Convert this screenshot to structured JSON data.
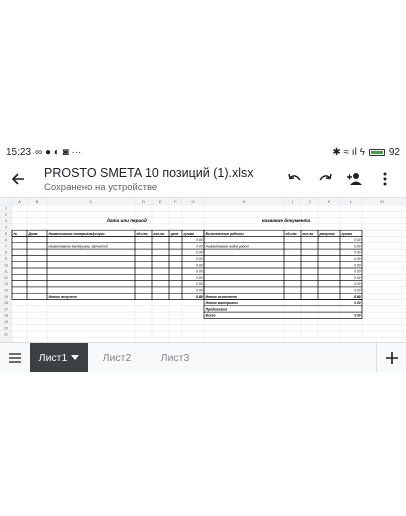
{
  "status": {
    "time": "15:23",
    "notif": "∞ ● ◐ ◙ ···",
    "sys": "✱ ≈ ıl ϟ",
    "battery": "92"
  },
  "header": {
    "title": "PROSTO SMETA 10 позиций (1).xlsx",
    "subtitle": "Сохранено на устройстве"
  },
  "icons": {
    "back": "arrow-left-icon",
    "undo": "undo-icon",
    "redo": "redo-icon",
    "share": "add-person-icon",
    "more": "more-vert-icon",
    "menu": "menu-icon",
    "add": "plus-icon"
  },
  "sheet": {
    "columns": [
      "A",
      "B",
      "C",
      "D",
      "E",
      "F",
      "G",
      "H",
      "I",
      "J",
      "K",
      "L",
      "M"
    ],
    "rows": [
      "1",
      "2",
      "3",
      "4",
      "5",
      "6",
      "7",
      "8",
      "9",
      "10",
      "11",
      "12",
      "13",
      "14",
      "15",
      "16",
      "17",
      "18",
      "19",
      "20",
      "21"
    ],
    "title_left": "дата или период",
    "title_right": "название документа",
    "headers": [
      "№",
      "Дата",
      "Наименование материала/услуги",
      "ед.изм.",
      "кол-во",
      "цена",
      "сумма",
      "Выполненные работы",
      "ед.изм.",
      "кол-во",
      "расценка",
      "сумма"
    ],
    "material_example": "наименование материала, запчастей",
    "work_example": "Наименование видов работ",
    "zero": "0.00",
    "total_received": "Итого получено",
    "total_received_value": "0.00",
    "summary": [
      {
        "label": "Итого выполнено",
        "value": "0.00"
      },
      {
        "label": "Итого материалы",
        "value": "0.00"
      },
      {
        "label": "Предоплата",
        "value": ""
      },
      {
        "label": "Всего",
        "value": "0.00"
      }
    ]
  },
  "tabs": [
    {
      "label": "Лист1"
    },
    {
      "label": "Лист2"
    },
    {
      "label": "Лист3"
    }
  ]
}
